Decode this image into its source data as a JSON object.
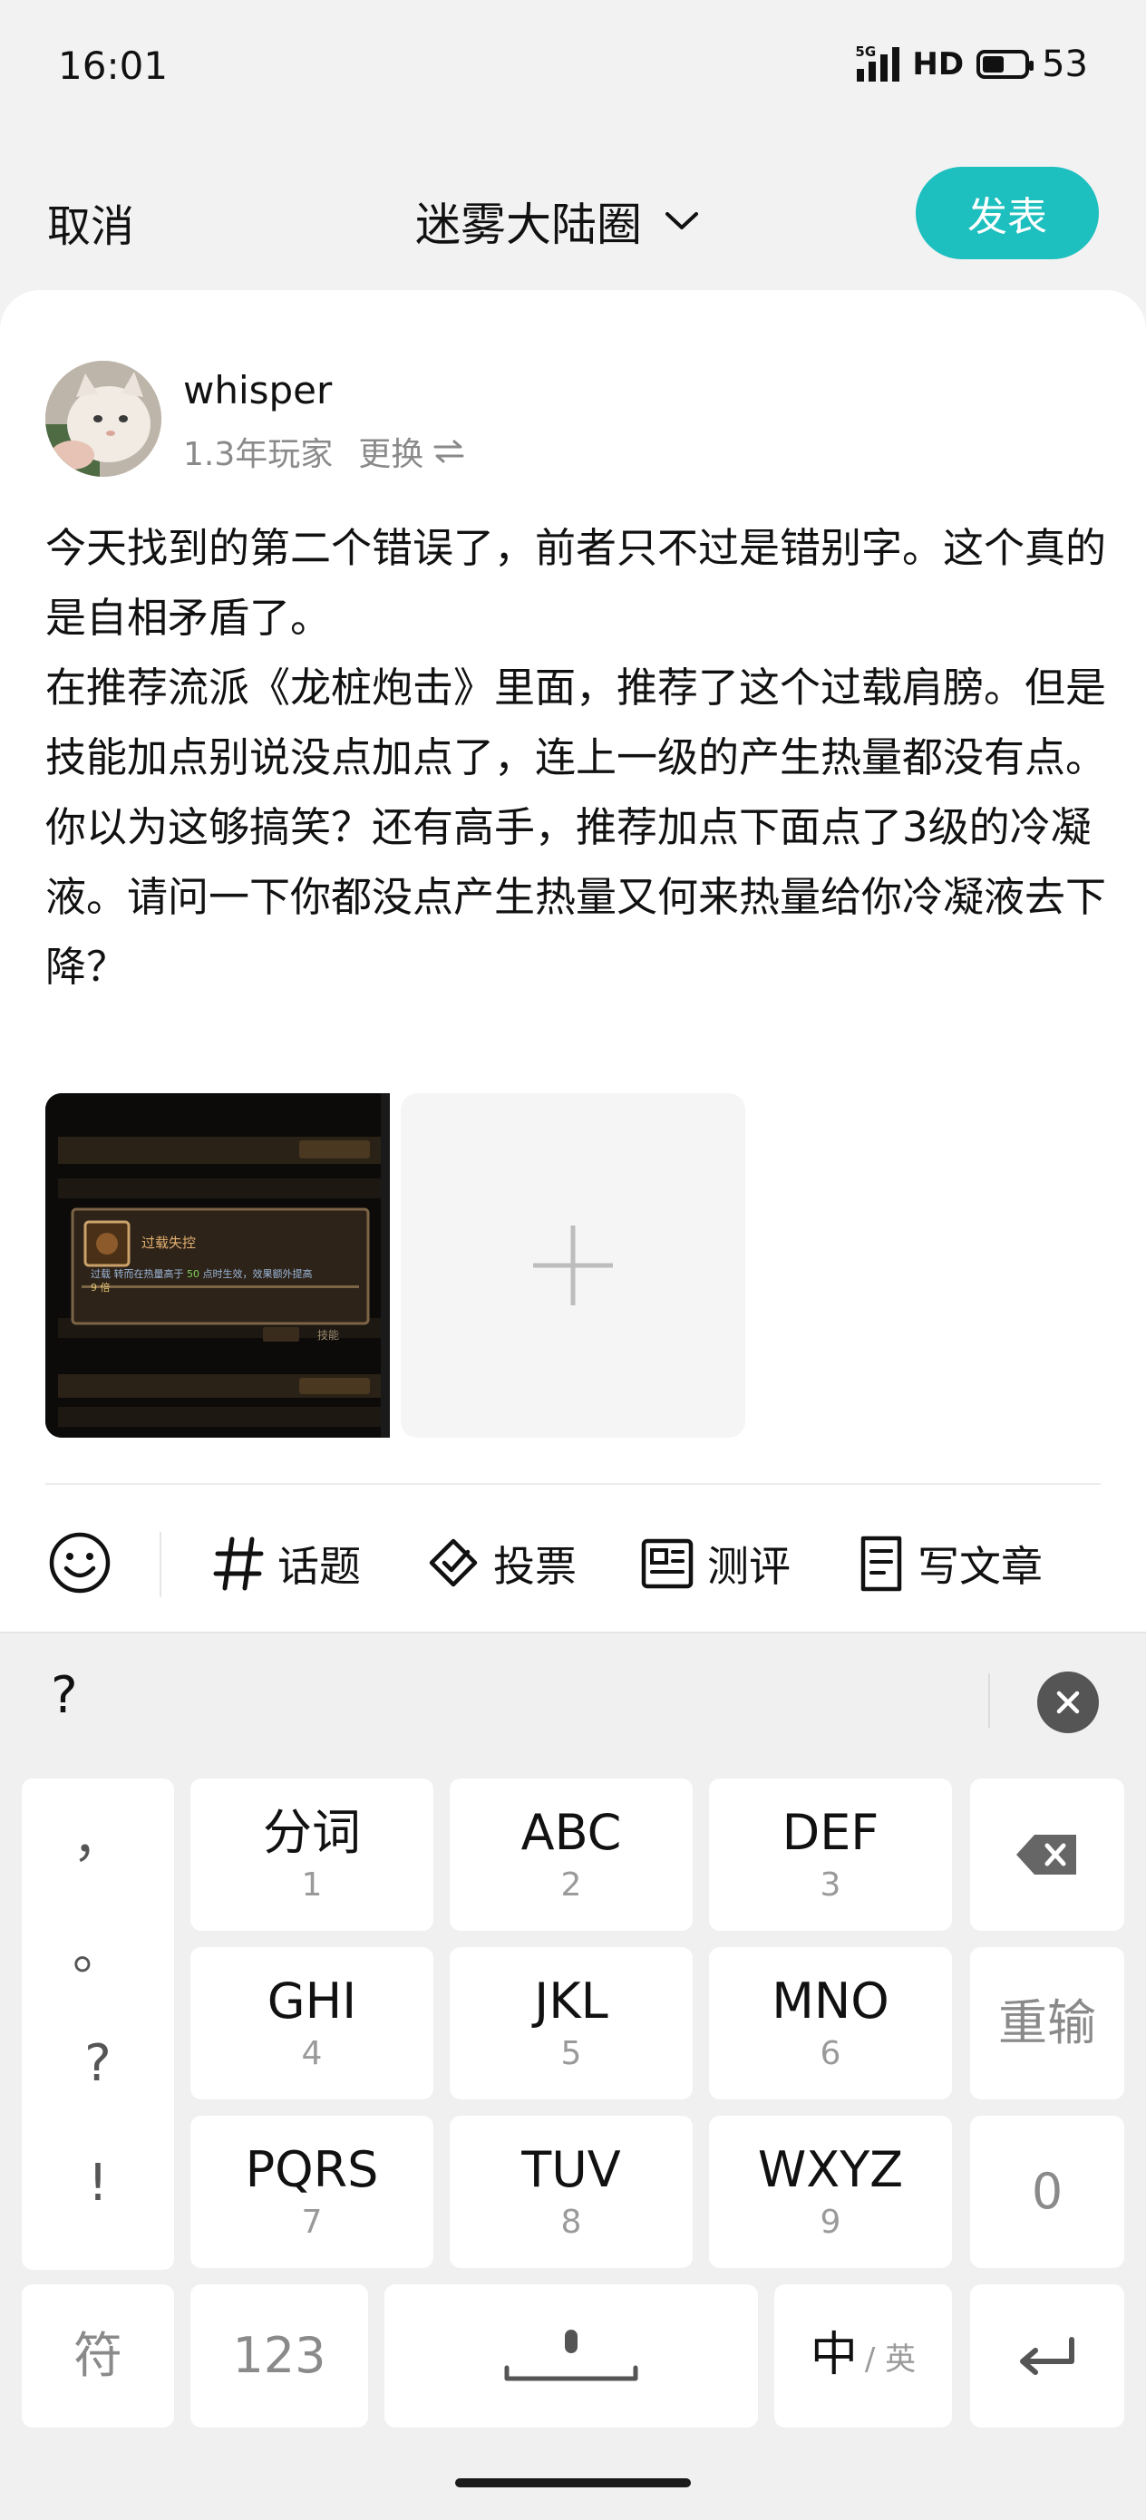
{
  "status": {
    "time": "16:01",
    "network": "5G",
    "hd": "HD",
    "battery": "53",
    "battery_level": 0.53
  },
  "header": {
    "cancel": "取消",
    "circle": "迷雾大陆圈",
    "publish": "发表"
  },
  "user": {
    "name": "whisper",
    "tenure": "1.3年玩家",
    "switch": "更换"
  },
  "post": {
    "text": "今天找到的第二个错误了，前者只不过是错别字。这个真的是自相矛盾了。\n在推荐流派《龙桩炮击》里面，推荐了这个过载肩膀。但是技能加点别说没点加点了，连上一级的产生热量都没有点。你以为这够搞笑？还有高手，推荐加点下面点了3级的冷凝液。请问一下你都没点产生热量又何来热量给你冷凝液去下降？"
  },
  "attachment": {
    "popup_title": "过载失控",
    "popup_desc_a": "过载 转而在热量高于",
    "popup_desc_num": "50",
    "popup_desc_b": "点时生效，效果额外提高",
    "popup_desc_c": "9 倍",
    "bg_label": "技能"
  },
  "toolbar": {
    "topic": "话题",
    "vote": "投票",
    "review": "测评",
    "article": "写文章"
  },
  "candidate": {
    "word": "?"
  },
  "keyboard": {
    "punct": [
      "，",
      "。",
      "?",
      "!"
    ],
    "rows": [
      [
        {
          "main": "分词",
          "sub": "1"
        },
        {
          "main": "ABC",
          "sub": "2"
        },
        {
          "main": "DEF",
          "sub": "3"
        }
      ],
      [
        {
          "main": "GHI",
          "sub": "4"
        },
        {
          "main": "JKL",
          "sub": "5"
        },
        {
          "main": "MNO",
          "sub": "6"
        }
      ],
      [
        {
          "main": "PQRS",
          "sub": "7"
        },
        {
          "main": "TUV",
          "sub": "8"
        },
        {
          "main": "WXYZ",
          "sub": "9"
        }
      ]
    ],
    "retype": "重输",
    "zero": "0",
    "symbols": "符",
    "numbers": "123",
    "lang_main": "中",
    "lang_alt": "/ 英"
  }
}
